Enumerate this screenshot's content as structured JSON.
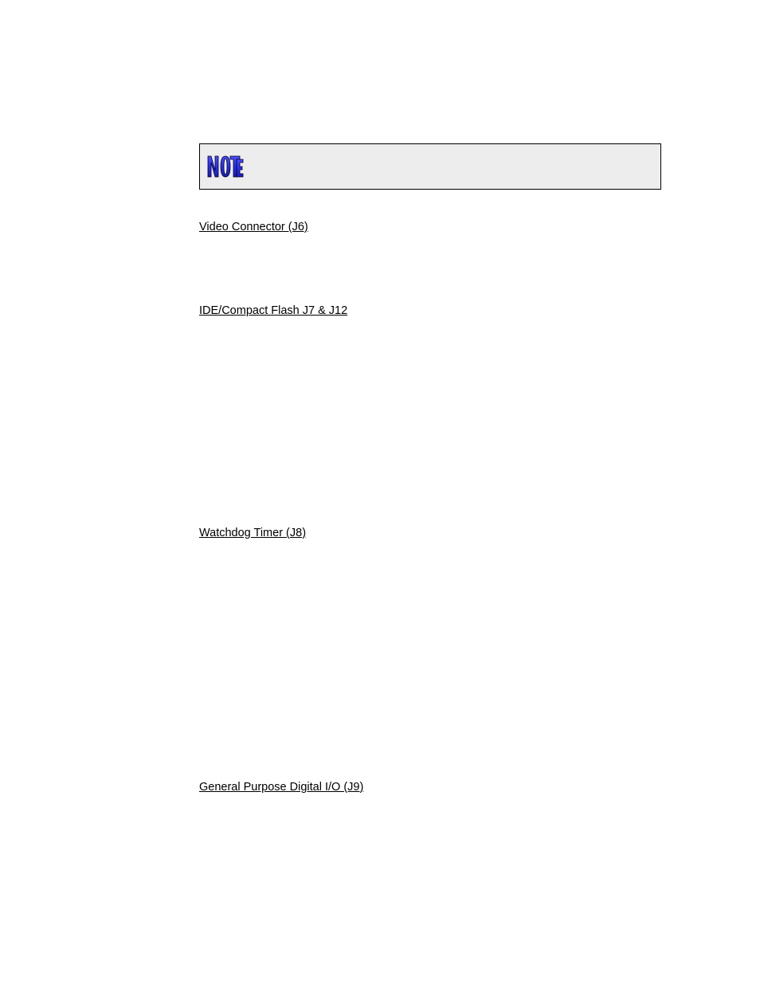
{
  "note": {
    "icon_label": "NOTE"
  },
  "sections": [
    {
      "label": "Video Connector (J6)"
    },
    {
      "label": "IDE/Compact Flash J7 & J12"
    },
    {
      "label": "Watchdog Timer (J8)"
    },
    {
      "label": "General Purpose Digital I/O (J9)"
    }
  ]
}
